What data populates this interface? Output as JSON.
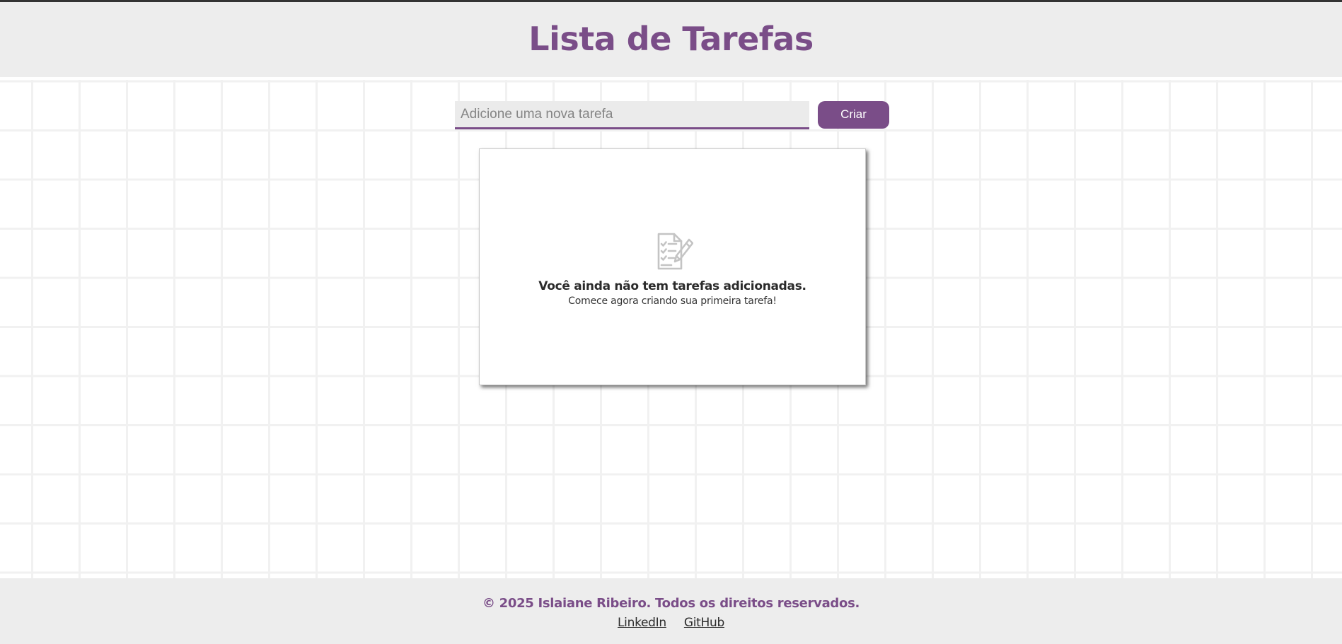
{
  "colors": {
    "accent": "#7a4d88",
    "header_bg": "#ededed",
    "footer_bg": "#ededed",
    "grid_line": "#f1f1f1"
  },
  "header": {
    "title": "Lista de Tarefas"
  },
  "form": {
    "input_value": "",
    "input_placeholder": "Adicione uma nova tarefa",
    "create_label": "Criar"
  },
  "task_list": {
    "empty_icon": "clipboard-checklist-pencil-icon",
    "empty_title": "Você ainda não tem tarefas adicionadas.",
    "empty_subtitle": "Comece agora criando sua primeira tarefa!"
  },
  "footer": {
    "copyright": "© 2025 Islaiane Ribeiro. Todos os direitos reservados.",
    "links": [
      {
        "label": "LinkedIn"
      },
      {
        "label": "GitHub"
      }
    ]
  }
}
